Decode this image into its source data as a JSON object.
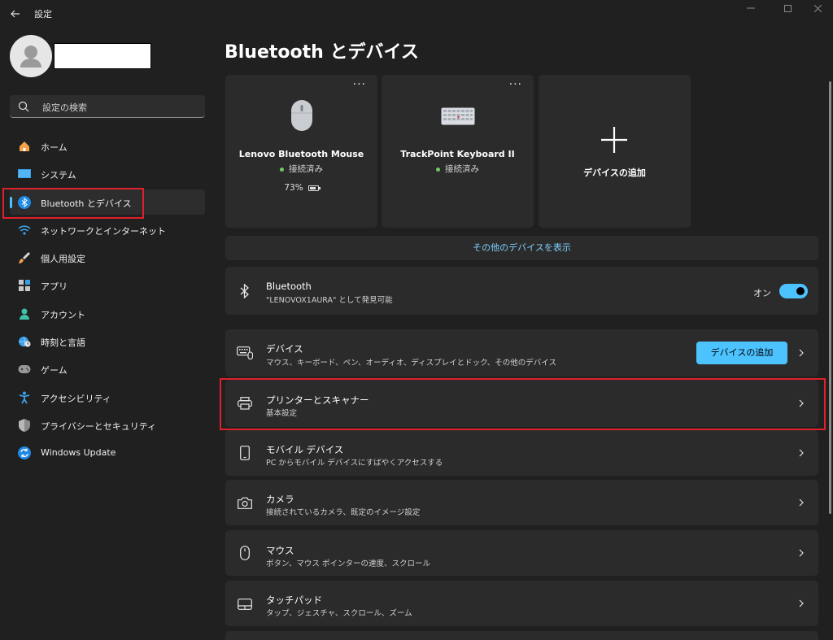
{
  "app": {
    "title": "設定"
  },
  "search": {
    "placeholder": "設定の検索"
  },
  "sidebar": {
    "items": [
      {
        "label": "ホーム",
        "icon": "home-icon"
      },
      {
        "label": "システム",
        "icon": "system-icon"
      },
      {
        "label": "Bluetooth とデバイス",
        "icon": "bluetooth-icon",
        "selected": true
      },
      {
        "label": "ネットワークとインターネット",
        "icon": "wifi-icon"
      },
      {
        "label": "個人用設定",
        "icon": "brush-icon"
      },
      {
        "label": "アプリ",
        "icon": "apps-icon"
      },
      {
        "label": "アカウント",
        "icon": "person-icon"
      },
      {
        "label": "時刻と言語",
        "icon": "globe-clock-icon"
      },
      {
        "label": "ゲーム",
        "icon": "gamepad-icon"
      },
      {
        "label": "アクセシビリティ",
        "icon": "accessibility-icon"
      },
      {
        "label": "プライバシーとセキュリティ",
        "icon": "shield-icon"
      },
      {
        "label": "Windows Update",
        "icon": "update-icon"
      }
    ]
  },
  "main": {
    "title": "Bluetooth とデバイス",
    "devices": [
      {
        "name": "Lenovo Bluetooth Mouse",
        "status": "接続済み",
        "battery": "73%",
        "battery_level": 0.73,
        "more": "···"
      },
      {
        "name": "TrackPoint Keyboard II",
        "status": "接続済み",
        "more": "···"
      }
    ],
    "add_card": {
      "label": "デバイスの追加"
    },
    "show_more": "その他のデバイスを表示",
    "bluetooth": {
      "title": "Bluetooth",
      "subtitle": "\"LENOVOX1AURA\" として発見可能",
      "toggle_label": "オン",
      "enabled": true
    },
    "rows": [
      {
        "title": "デバイス",
        "subtitle": "マウス、キーボード、ペン、オーディオ、ディスプレイとドック、その他のデバイス",
        "icon": "keyboard-devices-icon",
        "button": "デバイスの追加"
      },
      {
        "title": "プリンターとスキャナー",
        "subtitle": "基本設定",
        "icon": "printer-icon"
      },
      {
        "title": "モバイル デバイス",
        "subtitle": "PC からモバイル デバイスにすばやくアクセスする",
        "icon": "phone-icon"
      },
      {
        "title": "カメラ",
        "subtitle": "接続されているカメラ、既定のイメージ設定",
        "icon": "camera-icon"
      },
      {
        "title": "マウス",
        "subtitle": "ボタン、マウス ポインターの速度、スクロール",
        "icon": "mouse-icon"
      },
      {
        "title": "タッチパッド",
        "subtitle": "タップ、ジェスチャ、スクロール、ズーム",
        "icon": "touchpad-icon"
      }
    ]
  },
  "colors": {
    "accent": "#4cc2ff",
    "highlight": "#e0202a",
    "connected": "#6ccb5f"
  }
}
